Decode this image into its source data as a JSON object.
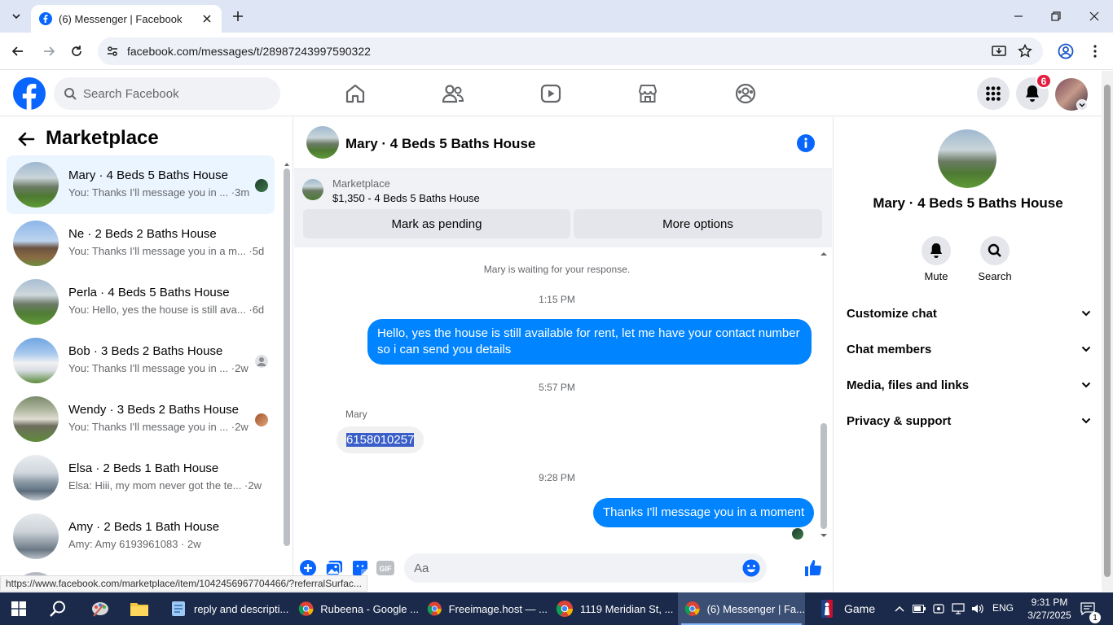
{
  "browser": {
    "tab_title": "(6) Messenger | Facebook",
    "url": "facebook.com/messages/t/28987243997590322",
    "status_url": "https://www.facebook.com/marketplace/item/1042456967704466/?referralSurfac..."
  },
  "fb": {
    "search_placeholder": "Search Facebook",
    "notification_count": "6",
    "brand_color": "#0866ff"
  },
  "left": {
    "title": "Marketplace",
    "conversations": [
      {
        "name": "Mary · 4 Beds 5 Baths House",
        "preview": "You: Thanks I'll message you in ... ·3m"
      },
      {
        "name": "Ne · 2 Beds 2 Baths House",
        "preview": "You: Thanks I'll message you in a m... ·5d"
      },
      {
        "name": "Perla · 4 Beds 5 Baths House",
        "preview": "You: Hello, yes the house is still ava... ·6d"
      },
      {
        "name": "Bob · 3 Beds 2 Baths House",
        "preview": "You: Thanks I'll message you in ... ·2w"
      },
      {
        "name": "Wendy · 3 Beds 2 Baths House",
        "preview": "You: Thanks I'll message you in ... ·2w"
      },
      {
        "name": "Elsa · 2 Beds 1 Bath House",
        "preview": "Elsa: Hiii, my mom never got the te... ·2w"
      },
      {
        "name": "Amy · 2 Beds 1 Bath House",
        "preview": "Amy: Amy 6193961083 · 2w"
      }
    ]
  },
  "chat": {
    "title": "Mary · 4 Beds 5 Baths House",
    "listing_label": "Marketplace",
    "listing_price": "$1,350 - 4 Beds 5 Baths House",
    "btn_pending": "Mark as pending",
    "btn_more": "More options",
    "waiting": "Mary is waiting for your response.",
    "time1": "1:15 PM",
    "msg1": "Hello, yes the house is still available for rent, let me have your contact number so i can send you  details",
    "time2": "5:57 PM",
    "sender": "Mary",
    "msg2": "6158010257",
    "time3": "9:28 PM",
    "msg3": "Thanks I'll message you in a moment",
    "composer_placeholder": "Aa"
  },
  "right": {
    "name": "Mary · 4 Beds 5 Baths House",
    "mute": "Mute",
    "search": "Search",
    "rows": [
      "Customize chat",
      "Chat members",
      "Media, files and links",
      "Privacy & support"
    ]
  },
  "taskbar": {
    "apps": [
      {
        "label": "reply and descripti..."
      },
      {
        "label": "Rubeena - Google ..."
      },
      {
        "label": "Freeimage.host — ..."
      },
      {
        "label": "1119 Meridian St, ..."
      },
      {
        "label": "(6) Messenger | Fa..."
      }
    ],
    "game": "Game",
    "lang": "ENG",
    "time": "9:31 PM",
    "date": "3/27/2025",
    "notif_count": "1"
  }
}
